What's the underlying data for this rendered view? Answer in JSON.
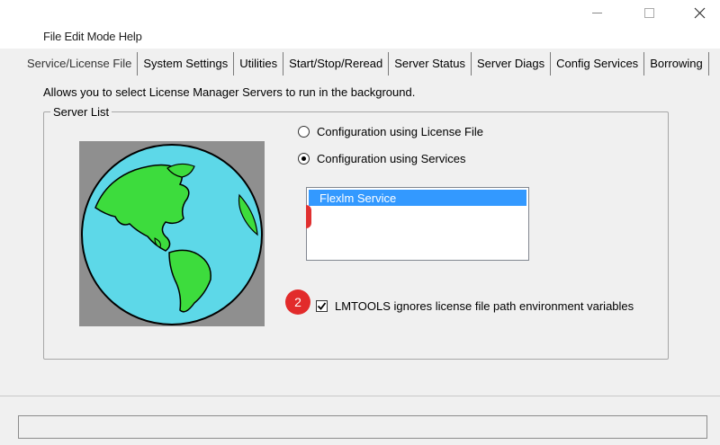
{
  "menubar": {
    "text": "File  Edit  Mode  Help"
  },
  "tabs": [
    "Service/License File",
    "System Settings",
    "Utilities",
    "Start/Stop/Reread",
    "Server Status",
    "Server Diags",
    "Config Services",
    "Borrowing"
  ],
  "info_text": "Allows you to select License Manager Servers to run in the background.",
  "server_list": {
    "title": "Server List",
    "radio_license_file": "Configuration using License File",
    "radio_services": "Configuration using Services",
    "selected_option": "services",
    "services": [
      "Flexlm Service"
    ]
  },
  "badge_number": "2",
  "checkbox": {
    "label": "LMTOOLS ignores license file path environment variables",
    "checked": true
  },
  "colors": {
    "selection": "#3399ff",
    "badge": "#e22b2b",
    "ocean": "#5dd8e8",
    "land": "#3ddc3d"
  },
  "icons": [
    "minimize-icon",
    "maximize-icon",
    "close-icon",
    "globe-icon",
    "checkmark-icon"
  ]
}
